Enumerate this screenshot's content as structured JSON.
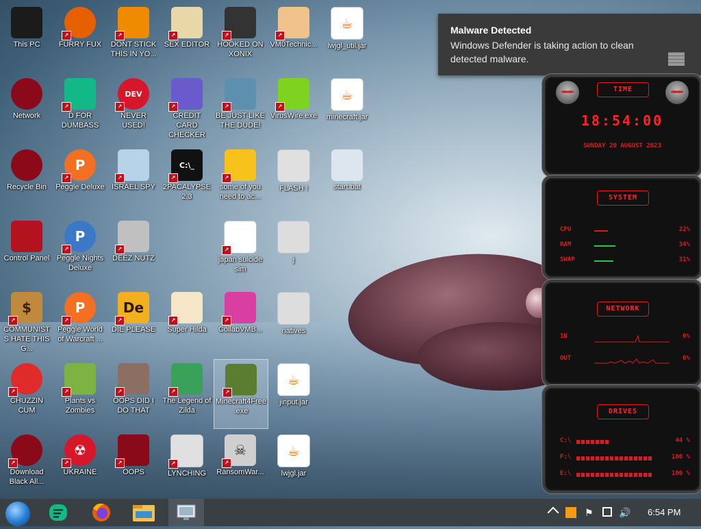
{
  "desktop": {
    "icons": [
      {
        "label": "This PC",
        "icon": "computer-icon",
        "color": "#1b1b1b"
      },
      {
        "label": "FURRY FUX",
        "icon": "firefox-icon",
        "color": "#e66000"
      },
      {
        "label": "DONT STICK THIS IN YO...",
        "icon": "vlc-cone-icon",
        "color": "#f08a00"
      },
      {
        "label": "SEX EDITOR",
        "icon": "hxd-icon",
        "color": "#e8d8a8"
      },
      {
        "label": "HOOKED ON XONIX",
        "icon": "xonix-icon",
        "color": "#333333"
      },
      {
        "label": "VM0Technic...",
        "icon": "doctor-icon",
        "color": "#f2c28c"
      },
      {
        "label": "lwjgl_util.jar",
        "icon": "java-jar-icon",
        "color": "#ffffff"
      },
      {
        "label": "Network",
        "icon": "network-icon",
        "color": "#8b0a1a"
      },
      {
        "label": "D FOR DUMBASS",
        "icon": "chat-icon",
        "color": "#12b886"
      },
      {
        "label": "NEVER USED!",
        "icon": "devcpp-icon",
        "color": "#d6172a"
      },
      {
        "label": "CREDIT CARD CHECKER",
        "icon": "credit-card-icon",
        "color": "#6a5acd"
      },
      {
        "label": "BE JUST LIKE THE DUDE!",
        "icon": "gnome-icon",
        "color": "#5d8fae"
      },
      {
        "label": "VirusWire.exe",
        "icon": "lime-icon",
        "color": "#7ed321"
      },
      {
        "label": "minecraft.jar",
        "icon": "java-jar-icon",
        "color": "#ffffff"
      },
      {
        "label": "Recycle Bin",
        "icon": "recycle-bin-icon",
        "color": "#8b0a1a"
      },
      {
        "label": "Peggle Deluxe",
        "icon": "peggle-icon",
        "color": "#f36f21"
      },
      {
        "label": "ISRAEL SPY",
        "icon": "spy-icon",
        "color": "#b7d3ea"
      },
      {
        "label": "2PACALYPSE 2.3",
        "icon": "terminal-icon",
        "color": "#111111"
      },
      {
        "label": "some of you need to ac...",
        "icon": "dog-icon",
        "color": "#f7c21b"
      },
      {
        "label": "FLASH !",
        "icon": "flash-icon",
        "color": "#e0e0e0"
      },
      {
        "label": "start.bat",
        "icon": "gear-file-icon",
        "color": "#dde6ef"
      },
      {
        "label": "Control Panel",
        "icon": "control-panel-icon",
        "color": "#b3121f"
      },
      {
        "label": "Peggle Nights Deluxe",
        "icon": "peggle-icon",
        "color": "#3b79c8"
      },
      {
        "label": "DEEZ NUTZ",
        "icon": "windows-stack-icon",
        "color": "#c0c0c0"
      },
      {
        "label": "japan suicide sim",
        "icon": "game-icon",
        "color": "#ffffff"
      },
      {
        "label": "j",
        "icon": "folder-icon",
        "color": "#dddddd"
      },
      {
        "label": "COMMUNISTS HATE THIS G...",
        "icon": "money-bag-icon",
        "color": "#c08a3e"
      },
      {
        "label": "Peggle World of Warcraft ...",
        "icon": "peggle-icon",
        "color": "#f36f21"
      },
      {
        "label": "DIE PLEASE",
        "icon": "de-icon",
        "color": "#f2b01e"
      },
      {
        "label": "Super Hilda",
        "icon": "pixel-character-icon",
        "color": "#f5e6c8"
      },
      {
        "label": "CollabVMB...",
        "icon": "monitor-icon",
        "color": "#d93fa0"
      },
      {
        "label": "natives",
        "icon": "folder-icon",
        "color": "#dddddd"
      },
      {
        "label": "CHUZZIN CUM",
        "icon": "chuzzle-icon",
        "color": "#e02b2b"
      },
      {
        "label": "Plants vs Zombies",
        "icon": "plant-icon",
        "color": "#7cb342"
      },
      {
        "label": "OOPS DID I DO THAT",
        "icon": "portrait-icon",
        "color": "#8d6e63"
      },
      {
        "label": "The Legend of Zilda",
        "icon": "pixel-character-icon",
        "color": "#3aa15a"
      },
      {
        "label": "Minecraft4Free.exe",
        "icon": "grass-block-icon",
        "color": "#5b7d2f"
      },
      {
        "label": "jinput.jar",
        "icon": "java-jar-icon",
        "color": "#ffffff"
      },
      {
        "label": "Download Black All...",
        "icon": "network-icon",
        "color": "#8b0a1a"
      },
      {
        "label": "UKRAINE",
        "icon": "radiation-icon",
        "color": "#d6172a"
      },
      {
        "label": "OOPS",
        "icon": "red-app-icon",
        "color": "#8b0a1a"
      },
      {
        "label": "LYNCHING",
        "icon": "noose-icon",
        "color": "#e0e0e0"
      },
      {
        "label": "RansomWar...",
        "icon": "skull-icon",
        "color": "#cfcfcf"
      },
      {
        "label": "lwjgl.jar",
        "icon": "java-jar-icon",
        "color": "#ffffff"
      }
    ]
  },
  "toast": {
    "title": "Malware Detected",
    "message": "Windows Defender is taking action to clean detected malware."
  },
  "widget": {
    "time_title": "TIME",
    "time": "18:54:00",
    "date": "SUNDAY 20 AUGUST 2023",
    "system_title": "SYSTEM",
    "system_rows": [
      {
        "name": "CPU",
        "value": "22%",
        "fraction": 0.22
      },
      {
        "name": "RAM",
        "value": "34%",
        "fraction": 0.34
      },
      {
        "name": "SWAP",
        "value": "31%",
        "fraction": 0.31
      }
    ],
    "network_title": "NETWORK",
    "network_rows": [
      {
        "name": "IN",
        "value": "0%"
      },
      {
        "name": "OUT",
        "value": "0%"
      }
    ],
    "drives_title": "DRIVES",
    "drive_rows": [
      {
        "name": "C:\\",
        "value": "44 %",
        "fraction": 0.44
      },
      {
        "name": "F:\\",
        "value": "100 %",
        "fraction": 1.0
      },
      {
        "name": "E:\\",
        "value": "100 %",
        "fraction": 1.0
      }
    ],
    "accent": "#e01a1a"
  },
  "taskbar": {
    "clock": "6:54 PM",
    "pinned": [
      {
        "icon": "start-orb-icon"
      },
      {
        "icon": "chat-icon"
      },
      {
        "icon": "firefox-icon"
      },
      {
        "icon": "file-explorer-icon"
      },
      {
        "icon": "control-panel-monitor-icon"
      }
    ]
  }
}
